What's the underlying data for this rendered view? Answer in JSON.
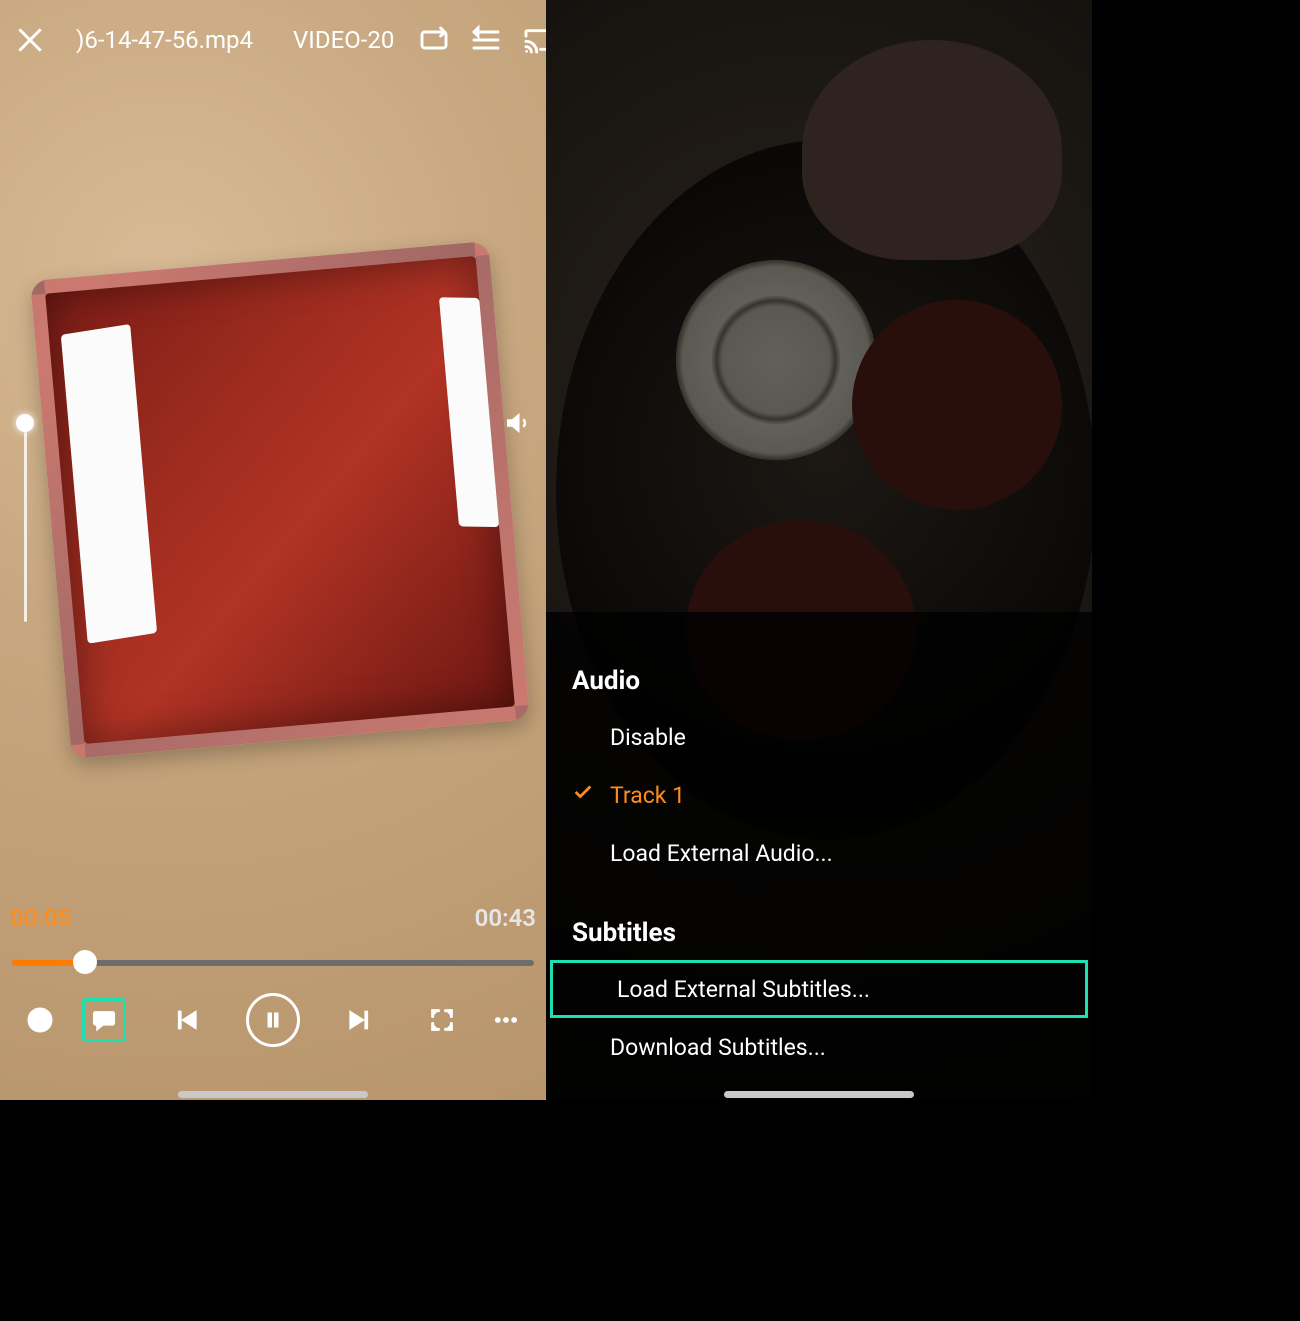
{
  "colors": {
    "accent": "#ff8c1a",
    "highlight": "#1de0b1"
  },
  "left": {
    "filename_visible": ")6-14-47-56.mp4",
    "title_next": "VIDEO-20",
    "current_time": "00:05",
    "duration": "00:43",
    "progress_percent": 12
  },
  "right": {
    "audio_header": "Audio",
    "audio_items": [
      {
        "label": "Disable",
        "selected": false
      },
      {
        "label": "Track 1",
        "selected": true
      },
      {
        "label": "Load External Audio...",
        "selected": false
      }
    ],
    "subtitles_header": "Subtitles",
    "subtitles_items": [
      {
        "label": "Load External Subtitles...",
        "highlighted": true
      },
      {
        "label": "Download Subtitles...",
        "highlighted": false
      }
    ]
  }
}
